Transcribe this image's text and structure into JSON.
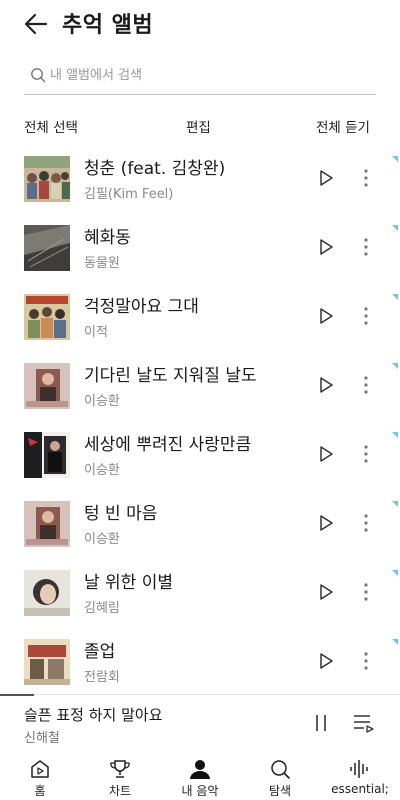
{
  "header": {
    "title": "추억 앨범"
  },
  "search": {
    "placeholder": "내 앨범에서 검색"
  },
  "actions": {
    "select_all": "전체 선택",
    "edit": "편집",
    "play_all": "전체 듣기"
  },
  "songs": [
    {
      "title": "청춘 (feat. 김창완)",
      "artist": "김필(Kim Feel)"
    },
    {
      "title": "혜화동",
      "artist": "동물원"
    },
    {
      "title": "걱정말아요 그대",
      "artist": "이적"
    },
    {
      "title": "기다린 날도 지워질 날도",
      "artist": "이승환"
    },
    {
      "title": "세상에 뿌려진 사랑만큼",
      "artist": "이승환"
    },
    {
      "title": "텅 빈 마음",
      "artist": "이승환"
    },
    {
      "title": "날 위한 이별",
      "artist": "김혜림"
    },
    {
      "title": "졸업",
      "artist": "전람회"
    }
  ],
  "now_playing": {
    "title": "슬픈 표정 하지 말아요",
    "artist": "신해철",
    "progress": 0.085
  },
  "nav": [
    {
      "label": "홈",
      "icon": "home-icon"
    },
    {
      "label": "차트",
      "icon": "trophy-icon"
    },
    {
      "label": "내 음악",
      "icon": "person-icon"
    },
    {
      "label": "탐색",
      "icon": "search-icon"
    },
    {
      "label": "essential;",
      "icon": "waveform-icon"
    }
  ],
  "colors": {
    "accent_triangle": "#6ec6e0",
    "text": "#1a1a1a",
    "subtext": "#8a8a8a"
  }
}
